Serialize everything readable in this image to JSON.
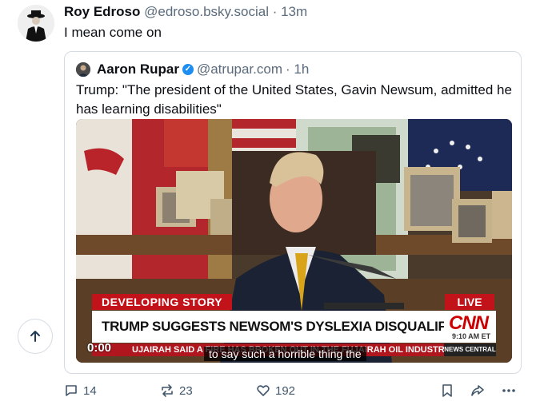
{
  "post": {
    "author_name": "Roy Edroso",
    "author_handle": "@edroso.bsky.social",
    "time": "· 13m",
    "text": "I mean come on"
  },
  "quote": {
    "author_name": "Aaron Rupar",
    "verified_mark": "✓",
    "author_handle": "@atrupar.com",
    "time": "· 1h",
    "text": "Trump: \"The president of the United States, Gavin Newsum, admitted he has learning disabilities\""
  },
  "video": {
    "chyron_label": "DEVELOPING STORY",
    "live_label": "LIVE",
    "headline": "TRUMP SUGGESTS NEWSOM'S DYSLEXIA DISQUALIFIES HIM FROM PRESIDENCY",
    "network": "CNN",
    "network_time": "9:10 AM ET",
    "ticker": "UJAIRAH SAID A FIRE HAS BROKEN OUT IN THE FUJAIRAH OIL INDUSTRY ZONE AS A",
    "ticker_brand": "NEWS CENTRAL",
    "timestamp": "0:00",
    "caption": "to say such a horrible thing the"
  },
  "actions": {
    "replies": "14",
    "reposts": "23",
    "likes": "192"
  },
  "icons": [
    "scroll-up-icon",
    "reply-icon",
    "repost-icon",
    "like-icon",
    "bookmark-icon",
    "share-icon",
    "more-icon"
  ]
}
